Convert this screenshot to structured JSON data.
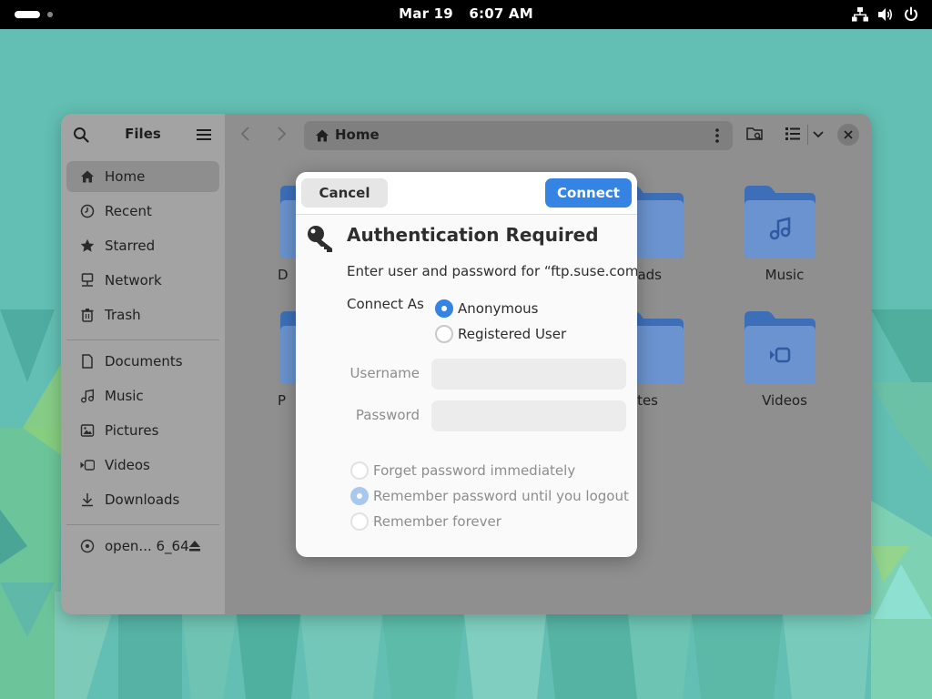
{
  "topbar": {
    "date": "Mar 19",
    "time": "6:07 AM",
    "icons": [
      "activities-indicator",
      "network-icon",
      "volume-icon",
      "power-icon"
    ]
  },
  "files_window": {
    "title": "Files",
    "path_label": "Home",
    "sidebar": {
      "places": [
        {
          "label": "Home",
          "icon": "home-icon",
          "active": true
        },
        {
          "label": "Recent",
          "icon": "clock-icon"
        },
        {
          "label": "Starred",
          "icon": "star-icon"
        },
        {
          "label": "Network",
          "icon": "network-icon"
        },
        {
          "label": "Trash",
          "icon": "trash-icon"
        }
      ],
      "bookmarks": [
        {
          "label": "Documents",
          "icon": "document-icon"
        },
        {
          "label": "Music",
          "icon": "music-icon"
        },
        {
          "label": "Pictures",
          "icon": "picture-icon"
        },
        {
          "label": "Videos",
          "icon": "video-icon"
        },
        {
          "label": "Downloads",
          "icon": "download-icon"
        }
      ],
      "devices": [
        {
          "label": "open... 6_64",
          "icon": "disc-icon"
        }
      ]
    },
    "folders": {
      "row1": [
        "D",
        "ads",
        "Music"
      ],
      "row2": [
        "P",
        "tes",
        "Videos"
      ]
    }
  },
  "auth_dialog": {
    "cancel_label": "Cancel",
    "connect_label": "Connect",
    "title": "Authentication Required",
    "message": "Enter user and password for “ftp.suse.com”:",
    "connect_as_label": "Connect As",
    "connect_as_options": [
      {
        "label": "Anonymous",
        "selected": true
      },
      {
        "label": "Registered User",
        "selected": false
      }
    ],
    "username_label": "Username",
    "username_value": "",
    "password_label": "Password",
    "password_value": "",
    "remember_options": [
      {
        "label": "Forget password immediately",
        "selected": false
      },
      {
        "label": "Remember password until you logout",
        "selected": true
      },
      {
        "label": "Remember forever",
        "selected": false
      }
    ]
  },
  "colors": {
    "accent": "#3584e4",
    "folder": "#6a9be0",
    "folder_dark": "#3f74c8",
    "desktop": "#63bfb3"
  }
}
